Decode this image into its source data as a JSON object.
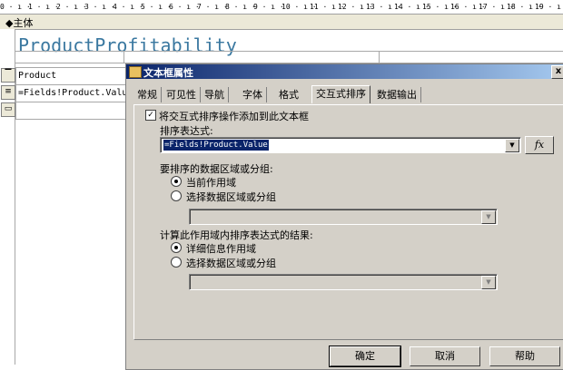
{
  "ruler": {
    "marks": [
      "0",
      "1",
      "2",
      "3",
      "4",
      "5",
      "6",
      "7",
      "8",
      "9",
      "10",
      "11",
      "12",
      "13",
      "14",
      "15",
      "16",
      "17",
      "18",
      "19"
    ]
  },
  "section": {
    "label": "◆主体"
  },
  "report": {
    "title": "ProductProfitability",
    "cells": [
      "Product",
      "=Fields!Product.Valu"
    ]
  },
  "dialog": {
    "title": "文本框属性",
    "close": "x",
    "tabs": [
      "常规",
      "可见性",
      "导航",
      "字体",
      "格式",
      "交互式排序",
      "数据输出"
    ],
    "active_tab": "交互式排序",
    "add_sort_checkbox": {
      "label": "将交互式排序操作添加到此文本框",
      "checked": true
    },
    "sort_expression_label": "排序表达式:",
    "sort_expression_value": "=Fields!Product.Value",
    "fx_label": "fx",
    "scope_group_label": "要排序的数据区域或分组:",
    "scope_options": [
      "当前作用域",
      "选择数据区域或分组"
    ],
    "scope_selected": 0,
    "evaluate_label": "计算此作用域内排序表达式的结果:",
    "evaluate_options": [
      "详细信息作用域",
      "选择数据区域或分组"
    ],
    "evaluate_selected": 0,
    "buttons": {
      "ok": "确定",
      "cancel": "取消",
      "help": "帮助"
    }
  }
}
